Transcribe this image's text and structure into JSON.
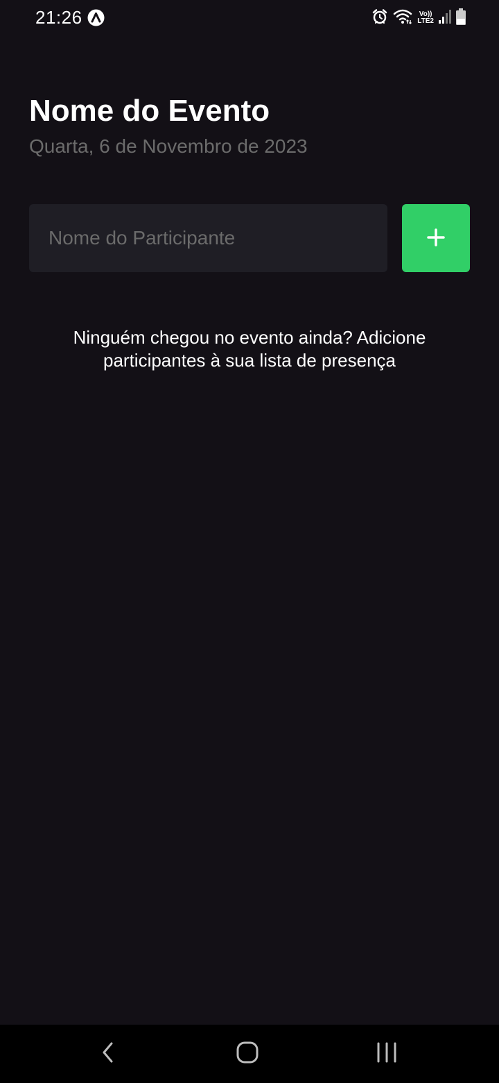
{
  "status_bar": {
    "time": "21:26",
    "app_icon": "arc-app-icon",
    "icons": [
      "alarm-icon",
      "wifi-icon",
      "volte-lte-icon",
      "signal-icon",
      "battery-icon"
    ],
    "volte_top": "Vo))",
    "volte_bottom": "LTE2"
  },
  "event": {
    "title": "Nome do Evento",
    "date": "Quarta, 6 de Novembro de 2023"
  },
  "form": {
    "participant_value": "",
    "participant_placeholder": "Nome do Participante",
    "add_button_icon": "plus-icon"
  },
  "list": {
    "empty_message": "Ninguém chegou no evento ainda? Adicione participantes à sua lista de presença"
  },
  "navigation": {
    "back_icon": "back-chevron-icon",
    "home_icon": "home-icon",
    "recents_icon": "recent-apps-icon"
  },
  "colors": {
    "background": "#131016",
    "input_background": "#1f1e25",
    "accent": "#31cf67",
    "muted_text": "#6b6b6b"
  }
}
